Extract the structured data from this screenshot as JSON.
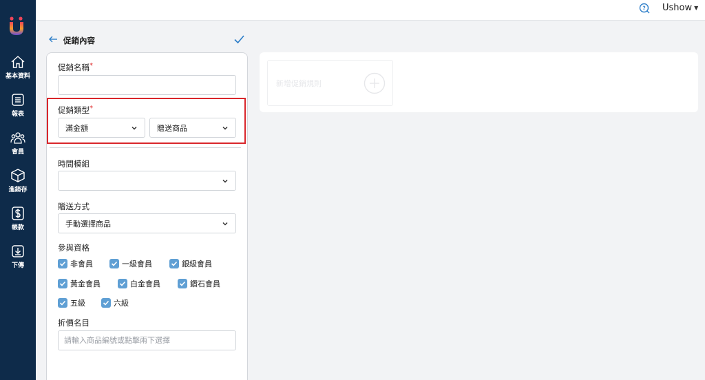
{
  "app": {
    "user_name": "Ushow"
  },
  "sidebar": {
    "items": [
      {
        "label": "基本資料",
        "icon": "home-icon"
      },
      {
        "label": "報表",
        "icon": "report-icon"
      },
      {
        "label": "會員",
        "icon": "members-icon"
      },
      {
        "label": "進銷存",
        "icon": "inventory-box-icon"
      },
      {
        "label": "帳款",
        "icon": "dollar-icon"
      },
      {
        "label": "下傳",
        "icon": "download-icon"
      }
    ]
  },
  "header": {
    "title": "促銷內容"
  },
  "form": {
    "promo_name": {
      "label": "促銷名稱",
      "required_mark": "*",
      "value": ""
    },
    "promo_type": {
      "label": "促銷類型",
      "required_mark": "*",
      "type_value": "滿金額",
      "subtype_value": "贈送商品"
    },
    "time_module": {
      "label": "時間模組",
      "value": ""
    },
    "gift_method": {
      "label": "贈送方式",
      "value": "手動選擇商品"
    },
    "eligibility": {
      "label": "參與資格",
      "options": [
        {
          "label": "非會員",
          "checked": true
        },
        {
          "label": "一級會員",
          "checked": true
        },
        {
          "label": "銀級會員",
          "checked": true
        },
        {
          "label": "黃金會員",
          "checked": true
        },
        {
          "label": "白金會員",
          "checked": true
        },
        {
          "label": "鑽石會員",
          "checked": true
        },
        {
          "label": "五級",
          "checked": true
        },
        {
          "label": "六級",
          "checked": true
        }
      ]
    },
    "discount_items": {
      "label": "折價名目",
      "placeholder": "請輸入商品編號或點擊兩下選擇"
    }
  },
  "rules": {
    "add_rule_label": "新增促銷規則"
  },
  "colors": {
    "sidebar_bg": "#0e2b4a",
    "accent": "#5f9fd4",
    "highlight": "#d9262b",
    "required": "#e03030"
  }
}
